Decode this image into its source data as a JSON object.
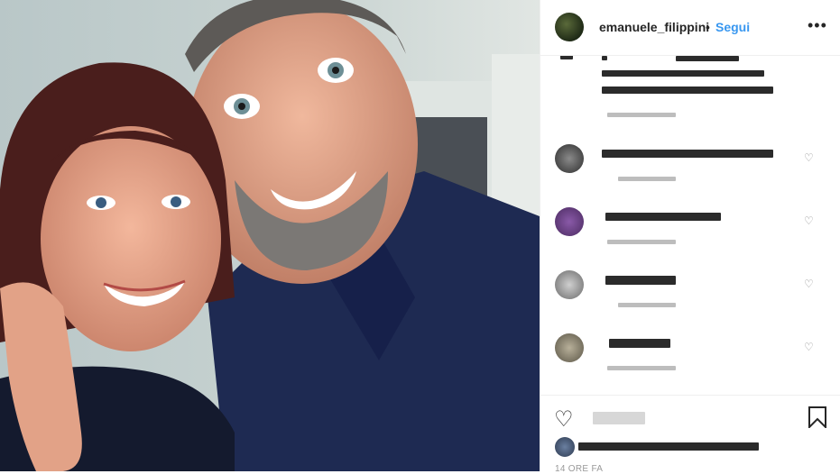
{
  "post": {
    "username": "emanuele_filippini",
    "separator": "•",
    "follow_label": "Segui",
    "more_label": "•••",
    "timestamp": "14 ORE FA"
  },
  "icons": {
    "heart": "♡",
    "like": "♡"
  },
  "colors": {
    "follow": "#3897f0",
    "text": "#262626",
    "muted": "#999999"
  }
}
